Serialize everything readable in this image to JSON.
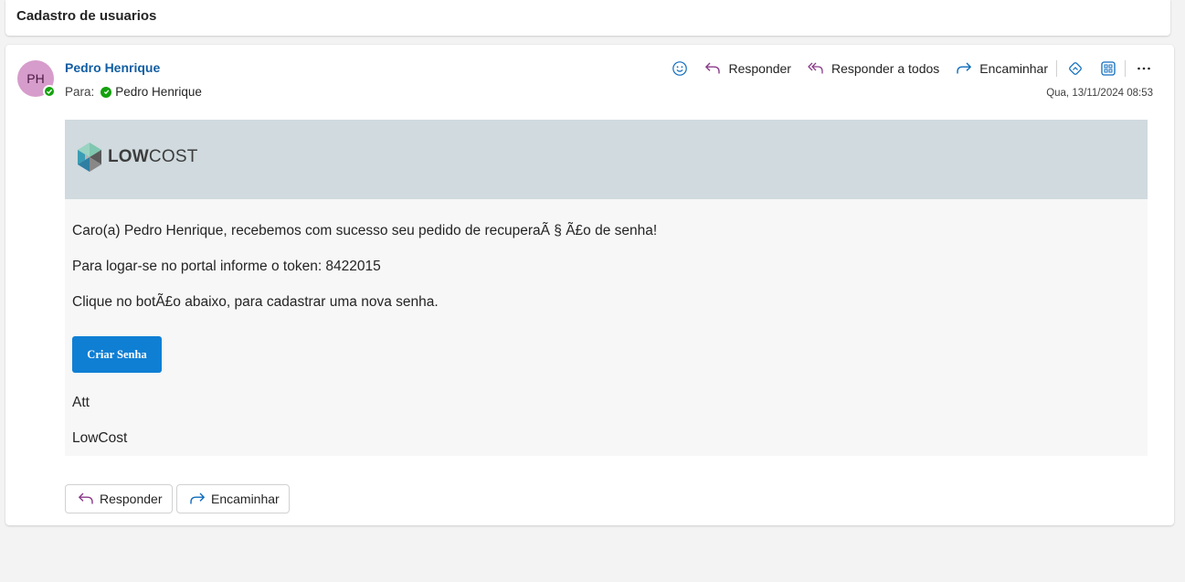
{
  "subject": "Cadastro de usuarios",
  "sender": {
    "initials": "PH",
    "name": "Pedro Henrique",
    "to_label": "Para:",
    "recipient": "Pedro Henrique"
  },
  "toolbar": {
    "reply": "Responder",
    "reply_all": "Responder a todos",
    "forward": "Encaminhar"
  },
  "date": "Qua, 13/11/2024 08:53",
  "email": {
    "logo_bold": "LOW",
    "logo_light": "COST",
    "line1": "Caro(a) Pedro Henrique, recebemos com sucesso seu pedido de recuperaÃ § Ã£o de senha!",
    "line2": "Para logar-se no portal informe o token: 8422015",
    "line3": "Clique no botÃ£o abaixo, para cadastrar uma nova senha.",
    "button": "Criar Senha",
    "closing": "Att",
    "signature": "LowCost"
  },
  "footer": {
    "reply": "Responder",
    "forward": "Encaminhar"
  },
  "colors": {
    "accent": "#0f7fd4",
    "sender_name": "#115ea3",
    "header_band": "#d0dadf",
    "presence": "#13a10e",
    "reply_icon": "#8a3b8a",
    "forward_icon": "#0f6cbd"
  },
  "icons": [
    "emoji-icon",
    "reply-icon",
    "reply-all-icon",
    "forward-icon",
    "ai-icon",
    "apps-icon",
    "more-icon"
  ]
}
